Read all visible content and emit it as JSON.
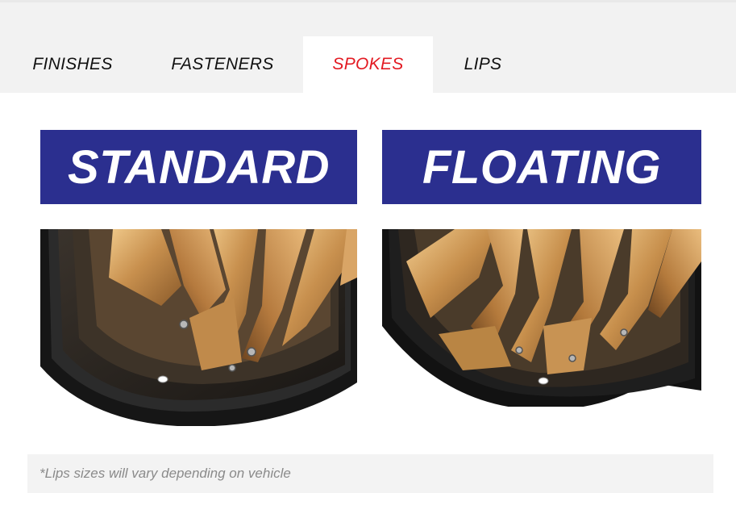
{
  "tabs": [
    {
      "label": "FINISHES",
      "active": false
    },
    {
      "label": "FASTENERS",
      "active": false
    },
    {
      "label": "SPOKES",
      "active": true
    },
    {
      "label": "LIPS",
      "active": false
    }
  ],
  "colors": {
    "accent": "#e31b23",
    "banner": "#2b2f8f",
    "note_bg": "#f3f3f3"
  },
  "options": [
    {
      "title": "STANDARD",
      "image": "standard-spoke-wheel-photo"
    },
    {
      "title": "FLOATING",
      "image": "floating-spoke-wheel-photo"
    }
  ],
  "note": "*Lips sizes will vary depending on vehicle"
}
